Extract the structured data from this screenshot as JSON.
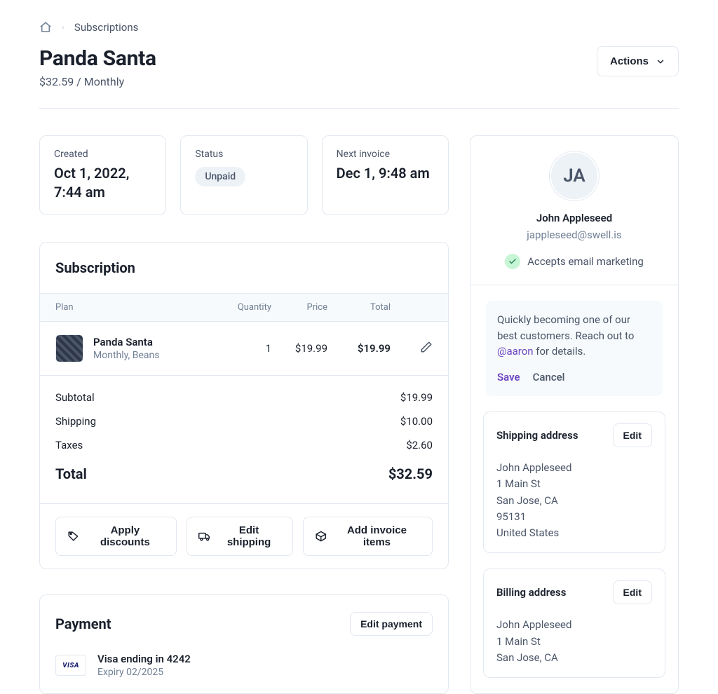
{
  "breadcrumb": {
    "section": "Subscriptions"
  },
  "header": {
    "title": "Panda Santa",
    "subtitle": "$32.59 / Monthly",
    "actions_label": "Actions"
  },
  "stats": {
    "created": {
      "label": "Created",
      "value": "Oct 1, 2022, 7:44 am"
    },
    "status": {
      "label": "Status",
      "value": "Unpaid"
    },
    "next": {
      "label": "Next invoice",
      "value": "Dec 1, 9:48 am"
    }
  },
  "subscription": {
    "title": "Subscription",
    "columns": {
      "plan": "Plan",
      "qty": "Quantity",
      "price": "Price",
      "total": "Total"
    },
    "item": {
      "name": "Panda Santa",
      "meta": "Monthly, Beans",
      "qty": "1",
      "price": "$19.99",
      "total": "$19.99"
    },
    "totals": {
      "subtotal_label": "Subtotal",
      "subtotal": "$19.99",
      "shipping_label": "Shipping",
      "shipping": "$10.00",
      "taxes_label": "Taxes",
      "taxes": "$2.60",
      "grand_label": "Total",
      "grand": "$32.59"
    },
    "buttons": {
      "discounts": "Apply discounts",
      "shipping": "Edit shipping",
      "invoice": "Add invoice items"
    }
  },
  "payment": {
    "title": "Payment",
    "edit_label": "Edit payment",
    "card_brand": "VISA",
    "card_label": "Visa ending in 4242",
    "card_expiry": "Expiry 02/2025"
  },
  "customer": {
    "initials": "JA",
    "name": "John Appleseed",
    "email": "jappleseed@swell.is",
    "email_marketing_label": "Accepts email marketing",
    "note_before": "Quickly becoming one of our best customers. Reach out to ",
    "note_mention": "@aaron",
    "note_after": " for details.",
    "save_label": "Save",
    "cancel_label": "Cancel"
  },
  "shipping": {
    "title": "Shipping address",
    "edit_label": "Edit",
    "lines": [
      "John Appleseed",
      "1 Main St",
      "San Jose, CA",
      "95131",
      "United States"
    ]
  },
  "billing": {
    "title": "Billing address",
    "edit_label": "Edit",
    "lines": [
      "John Appleseed",
      "1 Main St",
      "San Jose, CA"
    ]
  }
}
